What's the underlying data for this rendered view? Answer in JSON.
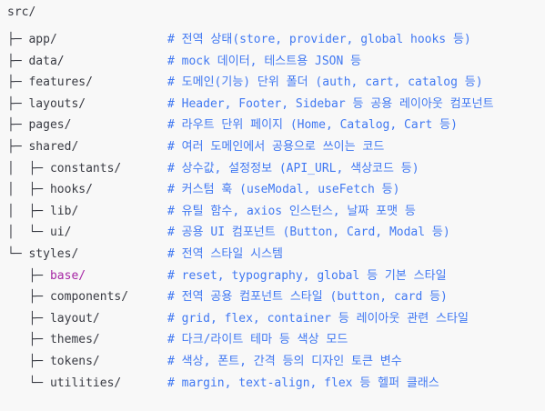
{
  "root": "src/",
  "entries": [
    {
      "prefix": "├─ ",
      "name": "app/",
      "comment": "# 전역 상태(store, provider, global hooks 등)"
    },
    {
      "prefix": "├─ ",
      "name": "data/",
      "comment": "# mock 데이터, 테스트용 JSON 등"
    },
    {
      "prefix": "├─ ",
      "name": "features/",
      "comment": "# 도메인(기능) 단위 폴더 (auth, cart, catalog 등)"
    },
    {
      "prefix": "├─ ",
      "name": "layouts/",
      "comment": "# Header, Footer, Sidebar 등 공용 레이아웃 컴포넌트"
    },
    {
      "prefix": "├─ ",
      "name": "pages/",
      "comment": "# 라우트 단위 페이지 (Home, Catalog, Cart 등)"
    },
    {
      "prefix": "├─ ",
      "name": "shared/",
      "comment": "# 여러 도메인에서 공용으로 쓰이는 코드"
    },
    {
      "prefix": "│  ├─ ",
      "name": "constants/",
      "comment": "# 상수값, 설정정보 (API_URL, 색상코드 등)"
    },
    {
      "prefix": "│  ├─ ",
      "name": "hooks/",
      "comment": "# 커스텀 훅 (useModal, useFetch 등)"
    },
    {
      "prefix": "│  ├─ ",
      "name": "lib/",
      "comment": "# 유틸 함수, axios 인스턴스, 날짜 포맷 등"
    },
    {
      "prefix": "│  └─ ",
      "name": "ui/",
      "comment": "# 공용 UI 컴포넌트 (Button, Card, Modal 등)"
    },
    {
      "prefix": "└─ ",
      "name": "styles/",
      "comment": "# 전역 스타일 시스템"
    },
    {
      "prefix": "   ├─ ",
      "name": "base/",
      "comment": "# reset, typography, global 등 기본 스타일",
      "highlight": true
    },
    {
      "prefix": "   ├─ ",
      "name": "components/",
      "comment": "# 전역 공용 컴포넌트 스타일 (button, card 등)"
    },
    {
      "prefix": "   ├─ ",
      "name": "layout/",
      "comment": "# grid, flex, container 등 레이아웃 관련 스타일"
    },
    {
      "prefix": "   ├─ ",
      "name": "themes/",
      "comment": "# 다크/라이트 테마 등 색상 모드"
    },
    {
      "prefix": "   ├─ ",
      "name": "tokens/",
      "comment": "# 색상, 폰트, 간격 등의 디자인 토큰 변수"
    },
    {
      "prefix": "   └─ ",
      "name": "utilities/",
      "comment": "# margin, text-align, flex 등 헬퍼 클래스"
    }
  ],
  "colors": {
    "background": "#f8f8f8",
    "text": "#383a42",
    "comment": "#4078f2",
    "keyword_dir": "#a626a4"
  }
}
